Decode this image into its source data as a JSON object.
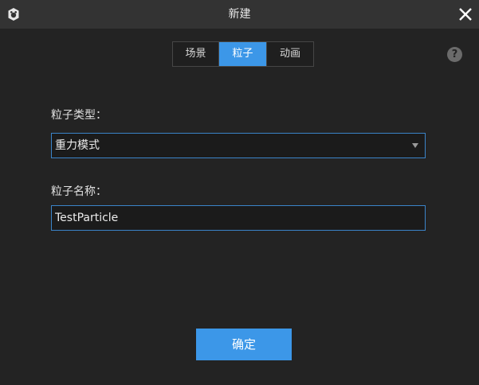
{
  "window": {
    "title": "新建",
    "close_icon": "close-icon",
    "app_icon": "app-logo-icon"
  },
  "tabs": [
    {
      "label": "场景",
      "active": false
    },
    {
      "label": "粒子",
      "active": true
    },
    {
      "label": "动画",
      "active": false
    }
  ],
  "help": {
    "label": "?"
  },
  "form": {
    "type_label": "粒子类型：",
    "type_value": "重力模式",
    "name_label": "粒子名称：",
    "name_value": "TestParticle"
  },
  "actions": {
    "confirm_label": "确定"
  },
  "colors": {
    "accent": "#3c97e8",
    "background": "#232323",
    "titlebar": "#333333",
    "field_border": "#3b84c9"
  }
}
